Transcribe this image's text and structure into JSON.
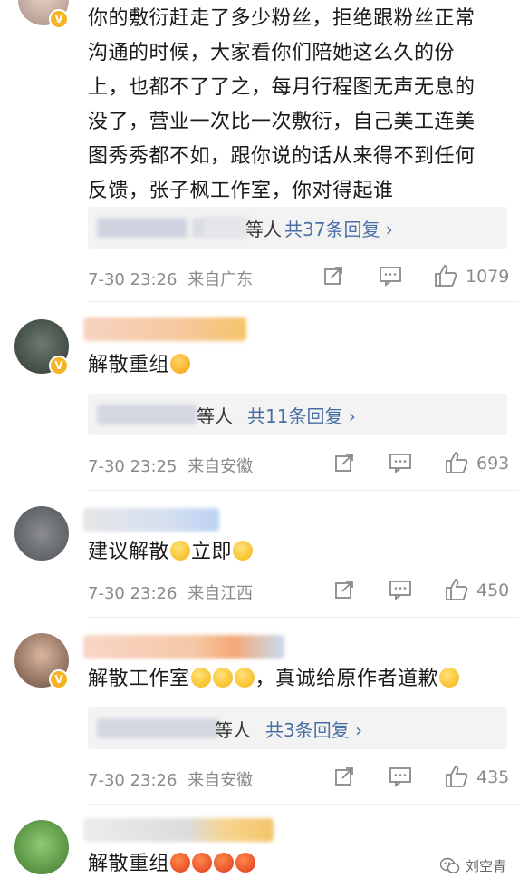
{
  "comments": [
    {
      "text_lines": [
        "你的敷衍赶走了多少粉丝，拒绝跟粉丝正常",
        "沟通的时候，大家看你们陪她这么久的份",
        "上，也都不了了之，每月行程图无声无息的",
        "没了，营业一次比一次敷衍，自己美工连美",
        "图秀秀都不如，跟你说的话从来得不到任何",
        "反馈，张子枫工作室，你对得起谁"
      ],
      "reply_deng": "等人",
      "reply_link": "共37条回复 ›",
      "time": "7-30 23:26",
      "location": "来自广东",
      "likes": "1079"
    },
    {
      "text": "解散重组",
      "reply_deng": "等人",
      "reply_link": "共11条回复 ›",
      "time": "7-30 23:25",
      "location": "来自安徽",
      "likes": "693"
    },
    {
      "text_a": "建议解散",
      "text_b": "立即",
      "time": "7-30 23:26",
      "location": "来自江西",
      "likes": "450"
    },
    {
      "text_a": "解散工作室",
      "text_b": "，真诚给原作者道歉",
      "reply_deng": "等人",
      "reply_link": "共3条回复 ›",
      "time": "7-30 23:26",
      "location": "来自安徽",
      "likes": "435"
    },
    {
      "text": "解散重组"
    }
  ],
  "watermark": "刘空青",
  "colors": {
    "link": "#4a6fa5",
    "meta": "#8a8a8a",
    "badge": "#f5b325"
  },
  "icons": [
    "share-icon",
    "comment-icon",
    "like-icon",
    "wechat-icon"
  ]
}
